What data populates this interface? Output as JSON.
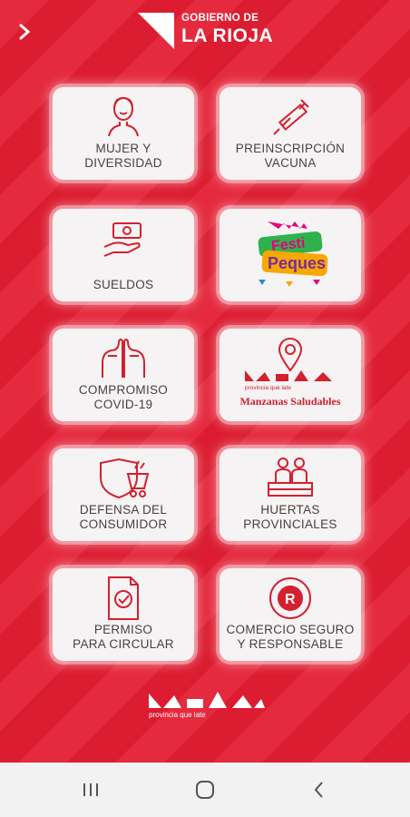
{
  "header": {
    "back_icon": "chevron-right-icon",
    "logo_line1": "GOBIERNO DE",
    "logo_line2": "LA RIOJA"
  },
  "cards": [
    {
      "label": "MUJER Y\nDIVERSIDAD",
      "icon": "woman-icon"
    },
    {
      "label": "PREINSCRIPCIÓN\nVACUNA",
      "icon": "syringe-icon"
    },
    {
      "label": "SUELDOS",
      "icon": "money-hand-icon"
    },
    {
      "label": "Festi Peques",
      "icon": "festi-peques-logo"
    },
    {
      "label": "COMPROMISO\nCOVID-19",
      "icon": "people-masks-icon"
    },
    {
      "label": "Manzanas Saludables",
      "sublabel": "provincia que late",
      "icon": "location-pin-icon"
    },
    {
      "label": "DEFENSA DEL\nCONSUMIDOR",
      "icon": "shield-cart-icon"
    },
    {
      "label": "HUERTAS\nPROVINCIALES",
      "icon": "garden-people-icon"
    },
    {
      "label": "PERMISO\nPARA CIRCULAR",
      "icon": "document-check-icon"
    },
    {
      "label": "COMERCIO SEGURO\nY RESPONSABLE",
      "icon": "r-seal-icon"
    }
  ],
  "footer": {
    "logo_tagline": "provincia que late"
  },
  "navbar": {
    "recent_icon": "recent-apps-icon",
    "home_icon": "home-icon",
    "back_icon": "back-icon"
  },
  "colors": {
    "brand_red": "#e31d32",
    "card_bg": "#f5f3f3",
    "text": "#4a3f3f"
  }
}
